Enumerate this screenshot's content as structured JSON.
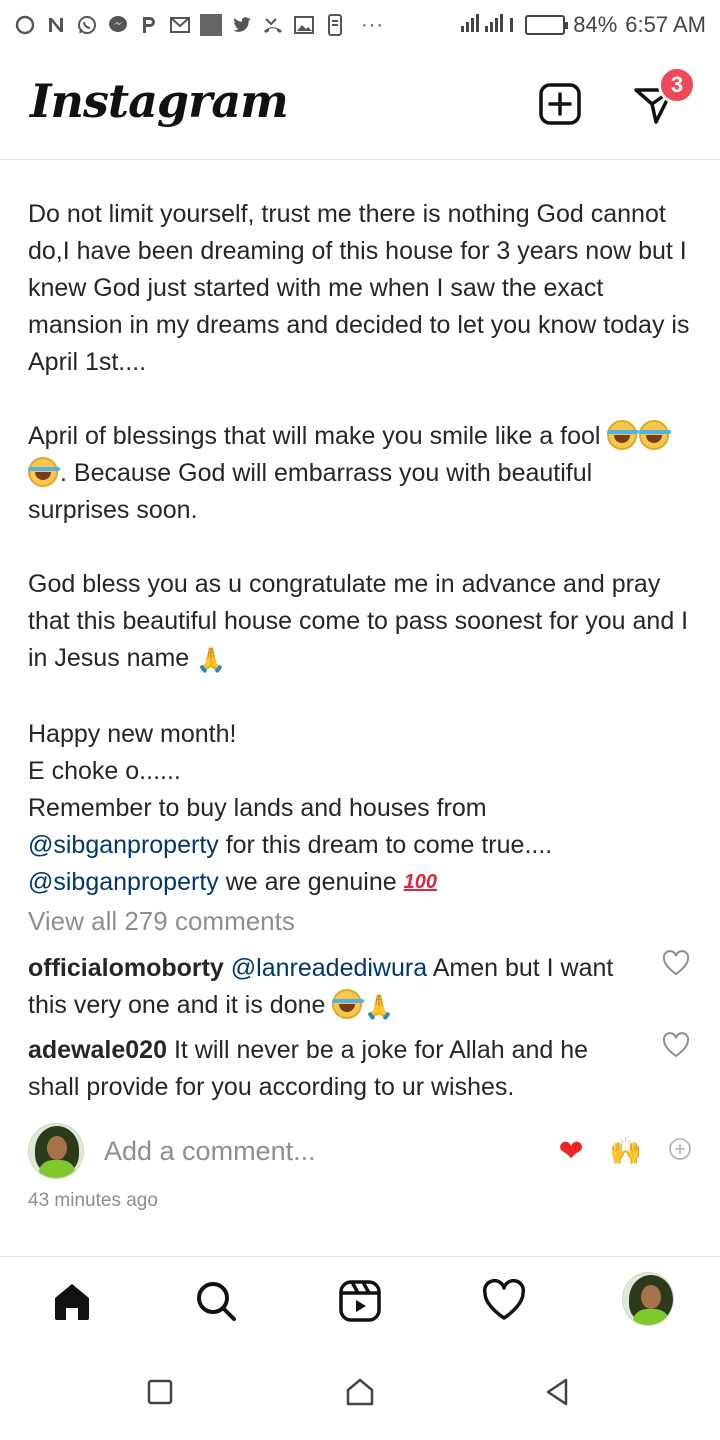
{
  "status_bar": {
    "icons": [
      "circle-icon",
      "n-icon",
      "whatsapp-icon",
      "messenger-icon",
      "p-icon",
      "gmail-icon",
      "image-thumb-icon",
      "twitter-icon",
      "missed-call-icon",
      "gallery-icon",
      "phone-icon"
    ],
    "more": "···",
    "battery_percent": "84%",
    "battery_level": 0.84,
    "time": "6:57 AM"
  },
  "header": {
    "logo": "Instagram",
    "direct_badge": "3"
  },
  "caption": {
    "para1": "Do not limit yourself, trust me there is nothing God cannot do,I have been dreaming of this house for 3 years now but I knew God just started with me when I saw the exact mansion in my dreams and decided to let you know today is April 1st....",
    "para2_a": "April of blessings that will make you smile like a fool ",
    "para2_b": ". Because God will embarrass you with beautiful surprises soon.",
    "para3": "God bless you as u congratulate me in advance and pray that this beautiful house come to pass soonest for you and I in Jesus name ",
    "line_happy": "Happy new month!",
    "line_choke": "E choke o......",
    "line_remember": "Remember to buy lands and houses  from",
    "mention": "@sibganproperty",
    "line_dream": " for this dream to come true....",
    "line_genuine": " we are genuine ",
    "emoji_100": "100"
  },
  "comments": {
    "view_all": "View all 279 comments",
    "items": [
      {
        "user": "officialomoborty",
        "mention": "@lanreadediwura",
        "text": " Amen but I want this very one and it is done "
      },
      {
        "user": "adewale020",
        "text": " It will never be a joke for Allah and he shall provide for you according to ur wishes."
      }
    ]
  },
  "add_comment": {
    "placeholder": "Add a comment..."
  },
  "timestamp": "43 minutes ago",
  "colors": {
    "mention": "#00376b",
    "muted": "#8e8e8e",
    "badge": "#ed4956",
    "heart": "#ed2424"
  }
}
